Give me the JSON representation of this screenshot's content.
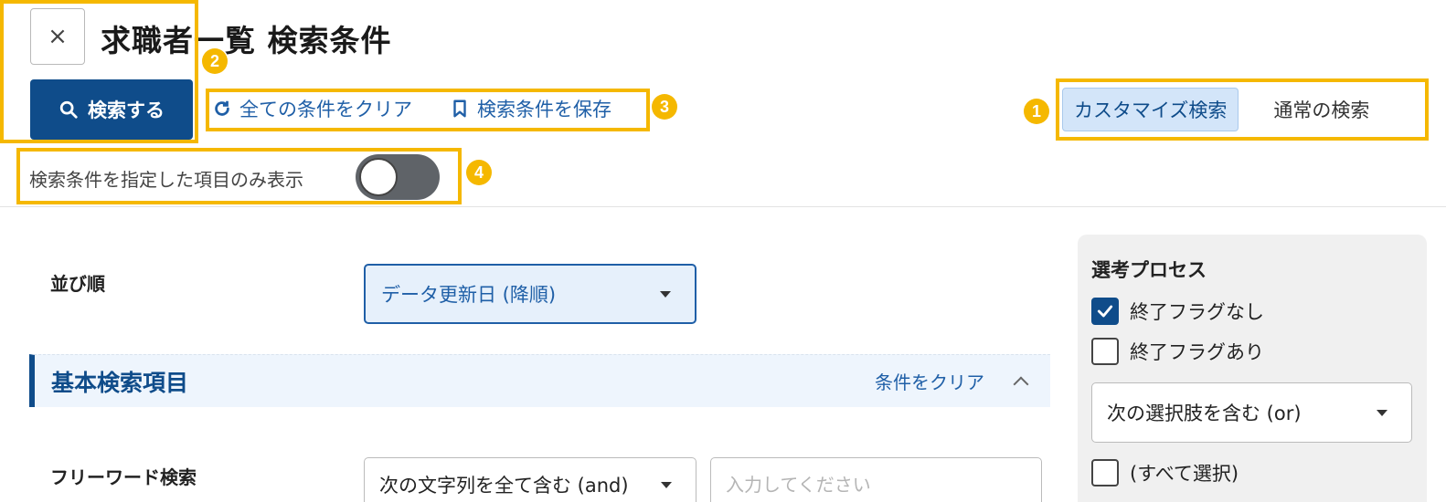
{
  "header": {
    "close_glyph": "×",
    "title": "求職者一覧 検索条件"
  },
  "toolbar": {
    "search_label": "検索する",
    "clear_all_label": "全ての条件をクリア",
    "save_label": "検索条件を保存",
    "filter_toggle_label": "検索条件を指定した項目のみ表示",
    "filter_toggle_on": false
  },
  "search_mode": {
    "options": [
      "カスタマイズ検索",
      "通常の検索"
    ],
    "selected": "カスタマイズ検索"
  },
  "annotations": [
    "1",
    "2",
    "3",
    "4"
  ],
  "main": {
    "sort": {
      "label": "並び順",
      "value": "データ更新日 (降順)"
    },
    "section": {
      "title": "基本検索項目",
      "clear_label": "条件をクリア"
    },
    "freeword": {
      "label": "フリーワード検索",
      "match_mode": "次の文字列を全て含む (and)",
      "placeholder": "入力してください"
    }
  },
  "side_panel": {
    "title": "選考プロセス",
    "options": [
      {
        "label": "終了フラグなし",
        "checked": true
      },
      {
        "label": "終了フラグあり",
        "checked": false
      }
    ],
    "match_mode": "次の選択肢を含む (or)",
    "select_all_label": "(すべて選択)",
    "select_all_checked": false
  },
  "colors": {
    "primary": "#0f4c8a",
    "link": "#1f5fa7",
    "annotation": "#f5b800",
    "active_tab_bg": "#d3e5f9"
  }
}
